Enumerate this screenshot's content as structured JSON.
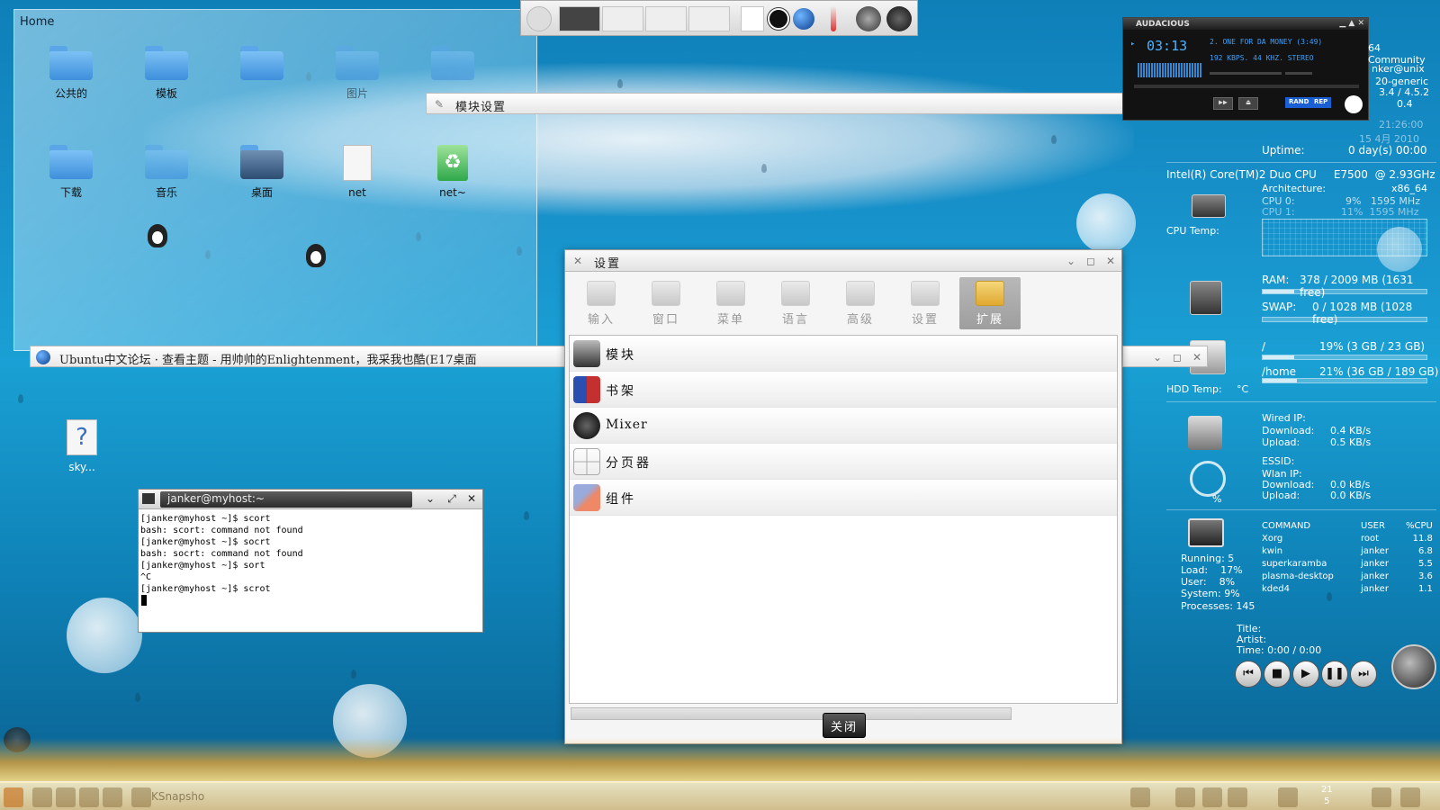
{
  "home": {
    "title": "Home",
    "items": [
      "公共的",
      "模板",
      "",
      "图片",
      "",
      "下载",
      "音乐",
      "桌面",
      "net",
      "net~"
    ]
  },
  "desktop": {
    "sky_label": "sky..."
  },
  "module_bar": {
    "title": "模块设置"
  },
  "audacious": {
    "title": "AUDACIOUS",
    "time": "03:13",
    "song": "2. ONE FOR DA MONEY (3:49)",
    "info": "192 KBPS. 44 KHZ. STEREO",
    "rand": "RAND",
    "rep": "REP"
  },
  "monitor": {
    "line_community": "64 Community",
    "user_host": "nker@unix",
    "kernel": "20-generic",
    "kde_version": "3.4 / 4.5.2",
    "load_value": "0.4",
    "time_faded": "21:26:00",
    "date_faded": "15 4月 2010",
    "uptime_label": "Uptime:",
    "uptime_value": "0 day(s)  00:00",
    "cpu_model": "Intel(R) Core(TM)2 Duo CPU     E7500  @ 2.93GHz",
    "arch_label": "Architecture:",
    "arch_value": "x86_64",
    "cpu0_label": "CPU 0:",
    "cpu0_value": "9%   1595 MHz",
    "cpu1_label": "CPU 1:",
    "cpu1_value": "11%  1595 MHz",
    "cpu_temp_label": "CPU Temp:",
    "ram_label": "RAM:",
    "ram_value": "378 / 2009 MB (1631 free)",
    "ram_fraction": 0.19,
    "swap_label": "SWAP:",
    "swap_value": "0 / 1028 MB (1028 free)",
    "swap_fraction": 0.0,
    "root_label": "/",
    "root_value": "19% (3 GB / 23 GB)",
    "root_fraction": 0.19,
    "home_label": "/home",
    "home_value": "21% (36 GB / 189 GB)",
    "home_fraction": 0.21,
    "hdd_temp_label": "HDD Temp:",
    "hdd_temp_unit": "°C",
    "wired_ip_label": "Wired IP:",
    "download_label": "Download:",
    "upload_label": "Upload:",
    "wired_down": "0.4 KB/s",
    "wired_up": "0.5 KB/s",
    "essid_label": "ESSID:",
    "wlan_ip_label": "Wlan IP:",
    "wlan_down": "0.0 kB/s",
    "wlan_up": "0.0 KB/s",
    "wifi_percent": "%",
    "running": "Running: 5",
    "load": "Load:    17%",
    "user": "User:    8%",
    "system": "System: 9%",
    "processes": "Processes: 145",
    "proc_headers": [
      "COMMAND",
      "USER",
      "%CPU"
    ],
    "procs": [
      [
        "Xorg",
        "root",
        "11.8"
      ],
      [
        "kwin",
        "janker",
        "6.8"
      ],
      [
        "superkaramba",
        "janker",
        "5.5"
      ],
      [
        "plasma-desktop",
        "janker",
        "3.6"
      ],
      [
        "kded4",
        "janker",
        "1.1"
      ]
    ],
    "title_label": "Title:",
    "artist_label": "Artist:",
    "time_label": "Time: 0:00 / 0:00"
  },
  "settings": {
    "title": "设置",
    "tabs": [
      "输入",
      "窗口",
      "菜单",
      "语言",
      "高级",
      "设置",
      "扩展"
    ],
    "rows": [
      "模块",
      "书架",
      "Mixer",
      "分页器",
      "组件"
    ],
    "close_label": "关闭"
  },
  "browser": {
    "title": "Ubuntu中文论坛 · 查看主题 - 用帅帅的Enlightenment，我采我也酷(E17桌面"
  },
  "terminal": {
    "title": "janker@myhost:~",
    "lines": [
      "[janker@myhost ~]$ scort",
      "bash: scort: command not found",
      "[janker@myhost ~]$ socrt",
      "bash: socrt: command not found",
      "[janker@myhost ~]$ sort",
      "^C",
      "[janker@myhost ~]$ scrot"
    ]
  },
  "taskbar": {
    "task_label": "KSnapsho",
    "clock_top": "21",
    "clock_bottom": "5"
  },
  "colors": {
    "desktop_blue": "#1790c9",
    "audacious_blue": "#39a0ff",
    "active_tab": "#9e9e9e"
  }
}
